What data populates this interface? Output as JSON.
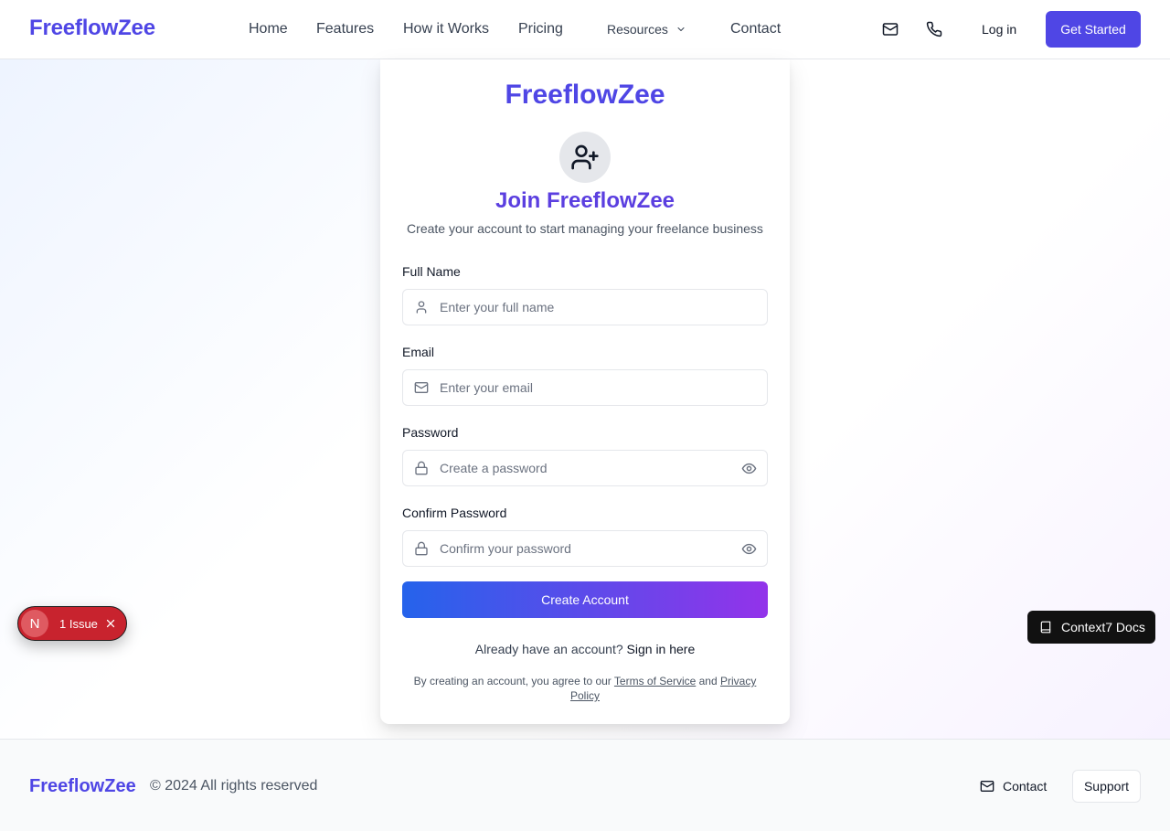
{
  "header": {
    "brand": "FreeflowZee",
    "nav": [
      "Home",
      "Features",
      "How it Works",
      "Pricing",
      "Resources",
      "Contact"
    ],
    "login": "Log in",
    "cta": "Get Started"
  },
  "card": {
    "brand": "FreeflowZee",
    "title": "Join FreeflowZee",
    "subtitle": "Create your account to start managing your freelance business",
    "fields": [
      {
        "label": "Full Name",
        "placeholder": "Enter your full name",
        "icon": "user-icon"
      },
      {
        "label": "Email",
        "placeholder": "Enter your email",
        "icon": "mail-icon"
      },
      {
        "label": "Password",
        "placeholder": "Create a password",
        "icon": "lock-icon"
      },
      {
        "label": "Confirm Password",
        "placeholder": "Confirm your password",
        "icon": "lock-icon"
      }
    ],
    "submit": "Create Account",
    "signin_prompt": "Already have an account?",
    "signin_link": "Sign in here",
    "terms_prefix": "By creating an account, you agree to our",
    "terms_link": "Terms of Service",
    "terms_and": "and",
    "privacy_link": "Privacy Policy"
  },
  "footer": {
    "brand": "FreeflowZee",
    "copyright": "© 2024 All rights reserved",
    "contact": "Contact",
    "support": "Support"
  },
  "badges": {
    "issue_letter": "N",
    "issue_text": "1 Issue",
    "docs": "Context7 Docs"
  },
  "colors": {
    "brand": "#4f46e5",
    "gradient_start": "#2563eb",
    "gradient_end": "#9333ea",
    "issue_red": "#c8232e"
  }
}
